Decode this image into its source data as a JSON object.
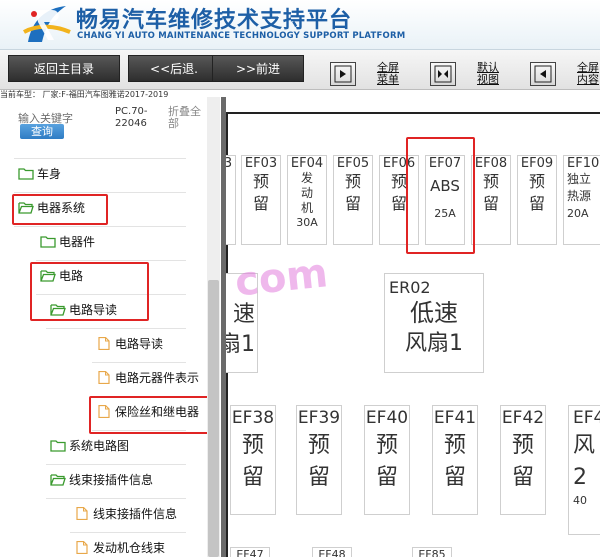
{
  "header": {
    "title_cn": "畅易汽车维修技术支持平台",
    "title_en": "CHANG YI AUTO MAINTENANCE TECHNOLOGY SUPPORT PLATFORM"
  },
  "toolbar": {
    "home_label": "返回主目录",
    "back_label": "<<后退.",
    "forward_label": ">>前进",
    "menu_label_1": "全屏",
    "menu_label_2": "菜单",
    "view_label_1": "默认",
    "view_label_2": "视图",
    "content_label_1": "全屏",
    "content_label_2": "内容"
  },
  "vehicle_info": "当前车型：  厂家:F-福田汽车图雅诺2017-2019",
  "search": {
    "placeholder": "输入关键字",
    "button_label": "查询",
    "code_line1": "PC.70-",
    "code_line2": "22046",
    "collapse_line1": "折叠全",
    "collapse_line2": "部"
  },
  "tree": {
    "n0": "车身",
    "n1": "电器系统",
    "n2": "电器件",
    "n3": "电路",
    "n4": "电路导读",
    "n5": "电路导读",
    "n6": "电路元器件表示",
    "n7": "保险丝和继电器",
    "n8": "系统电路图",
    "n9": "线束接插件信息",
    "n10": "线束接插件信息",
    "n11": "发动机仓线束"
  },
  "diagram": {
    "fuses_top": [
      {
        "code": "EF03",
        "name": "预留",
        "amp": ""
      },
      {
        "code": "EF04",
        "name": "发动机",
        "amp": "30A"
      },
      {
        "code": "EF05",
        "name": "预留",
        "amp": ""
      },
      {
        "code": "EF06",
        "name": "预留",
        "amp": ""
      },
      {
        "code": "EF07",
        "name": "ABS",
        "amp": "25A"
      },
      {
        "code": "EF08",
        "name": "预留",
        "amp": ""
      },
      {
        "code": "EF09",
        "name": "预留",
        "amp": ""
      },
      {
        "code": "EF10",
        "name": "独立热源",
        "amp": "20A"
      }
    ],
    "left_partial": {
      "name1": "速",
      "name2": "扇1"
    },
    "er02": {
      "code": "ER02",
      "name1": "低速",
      "name2": "风扇1"
    },
    "fuses_bottom": [
      {
        "code": "EF38",
        "name": "预留"
      },
      {
        "code": "EF39",
        "name": "预留"
      },
      {
        "code": "EF40",
        "name": "预留"
      },
      {
        "code": "EF41",
        "name": "预留"
      },
      {
        "code": "EF42",
        "name": "预留"
      },
      {
        "code": "EF4",
        "name": "风2",
        "amp": "40"
      }
    ],
    "bottom_partial": [
      "EF47",
      "EF48",
      "EF85"
    ],
    "watermark": "com"
  },
  "colors": {
    "brand": "#1d5fa6",
    "highlight": "#e02424",
    "folder_green": "#3a9a2e",
    "file_orange": "#e8a84a"
  }
}
